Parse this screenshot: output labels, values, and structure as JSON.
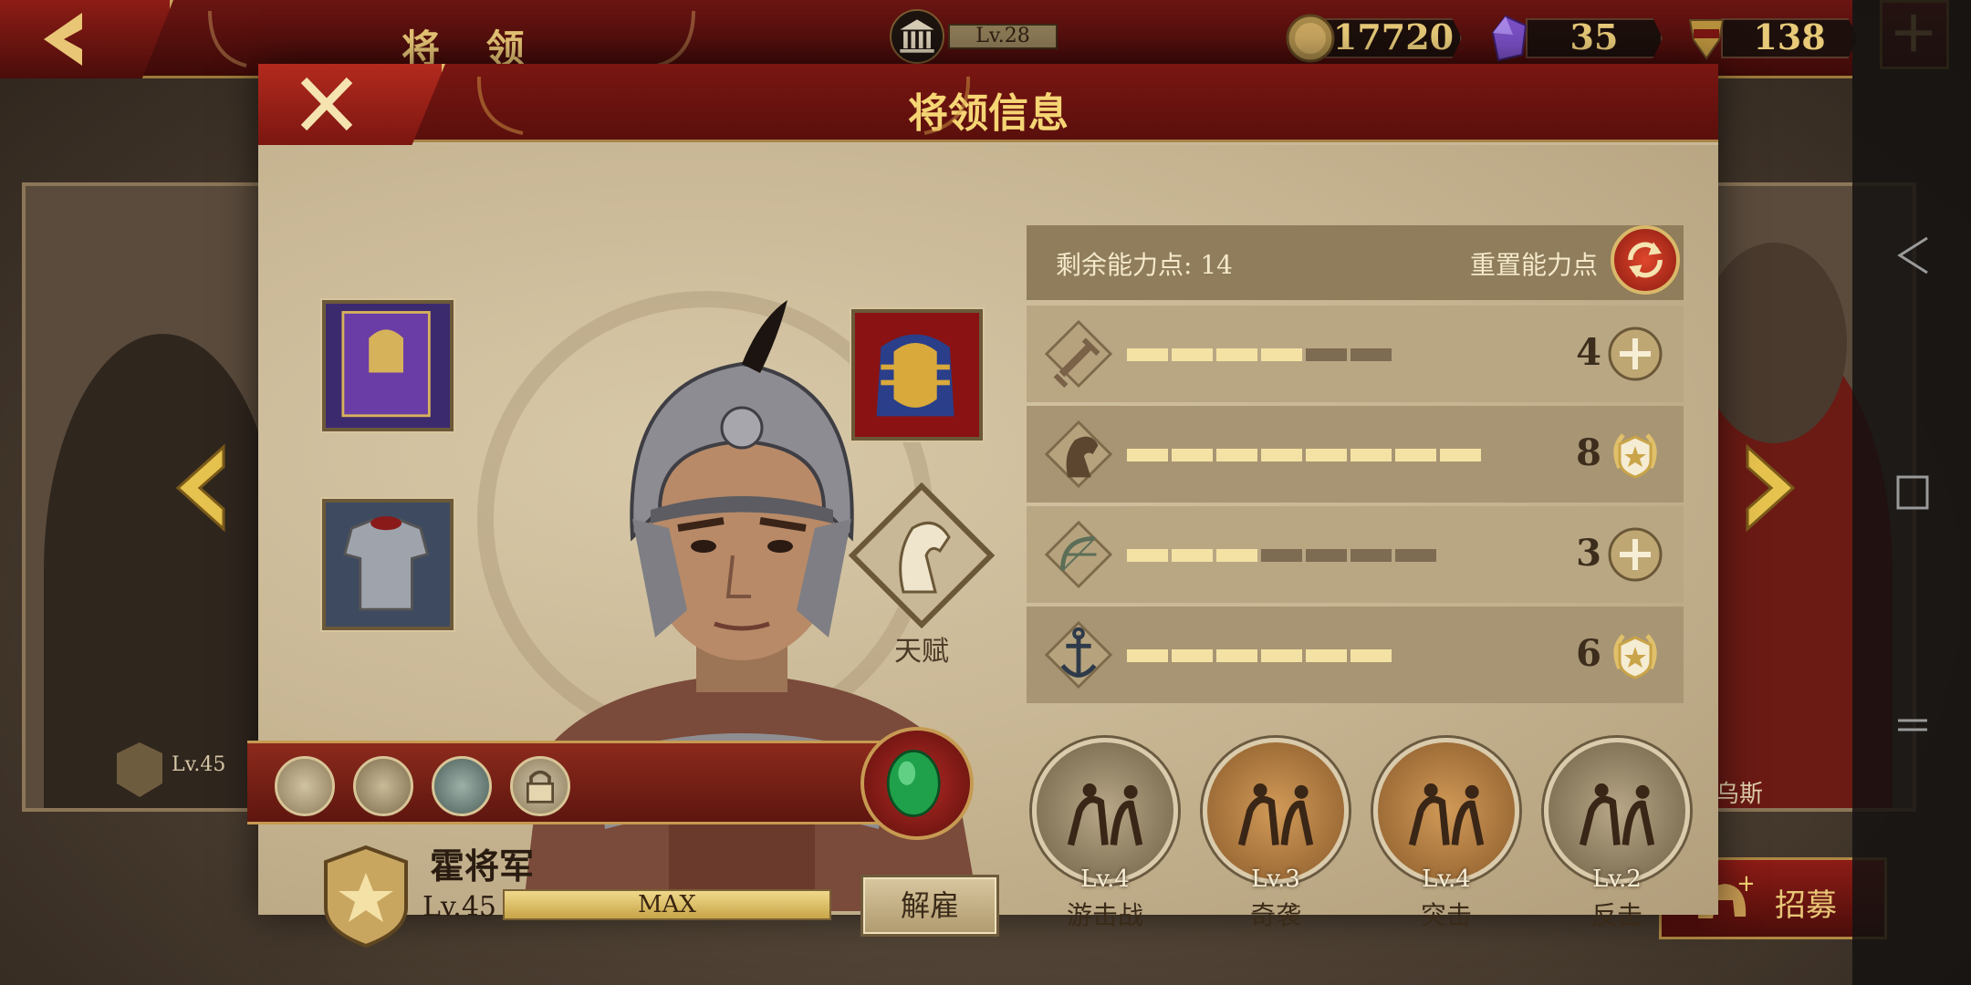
{
  "topbar": {
    "title": "将 领",
    "level": "Lv.28",
    "resources": [
      {
        "name": "gold",
        "icon": "coin-icon",
        "value": "17720"
      },
      {
        "name": "gem",
        "icon": "purple-gem-icon",
        "value": "35"
      },
      {
        "name": "honor",
        "icon": "spqr-emblem-icon",
        "value": "138"
      }
    ]
  },
  "background": {
    "left_card_level": "Lv.45",
    "right_card_name": "乌斯",
    "recruit_label": "招募"
  },
  "modal": {
    "title": "将领信息",
    "talent_label": "天赋",
    "general": {
      "name": "霍将军",
      "level": "Lv.45",
      "xp_label": "MAX",
      "dismiss_label": "解雇"
    },
    "points": {
      "remaining_label": "剩余能力点:",
      "remaining_value": "14",
      "reset_label": "重置能力点"
    },
    "attributes": [
      {
        "icon": "sword-icon",
        "value": 4,
        "max": 8,
        "filled": 4,
        "total": 6,
        "action": "plus"
      },
      {
        "icon": "horse-icon",
        "value": 8,
        "max": 8,
        "filled": 8,
        "total": 8,
        "action": "laurel"
      },
      {
        "icon": "bow-icon",
        "value": 3,
        "max": 8,
        "filled": 3,
        "total": 7,
        "action": "plus"
      },
      {
        "icon": "anchor-icon",
        "value": 6,
        "max": 8,
        "filled": 6,
        "total": 6,
        "action": "laurel"
      }
    ],
    "abilities": [
      {
        "level": "Lv.4",
        "name": "游击战",
        "tone": "dark"
      },
      {
        "level": "Lv.3",
        "name": "奇袭",
        "tone": "bronze"
      },
      {
        "level": "Lv.4",
        "name": "突击",
        "tone": "bronze"
      },
      {
        "level": "Lv.2",
        "name": "反击",
        "tone": "dark"
      }
    ]
  },
  "colors": {
    "accent_gold": "#e8c676",
    "header_red": "#7a1612",
    "panel_tan": "#c9b898",
    "bar_filled": "#f3e2a4",
    "bar_empty": "#7d6c52"
  }
}
